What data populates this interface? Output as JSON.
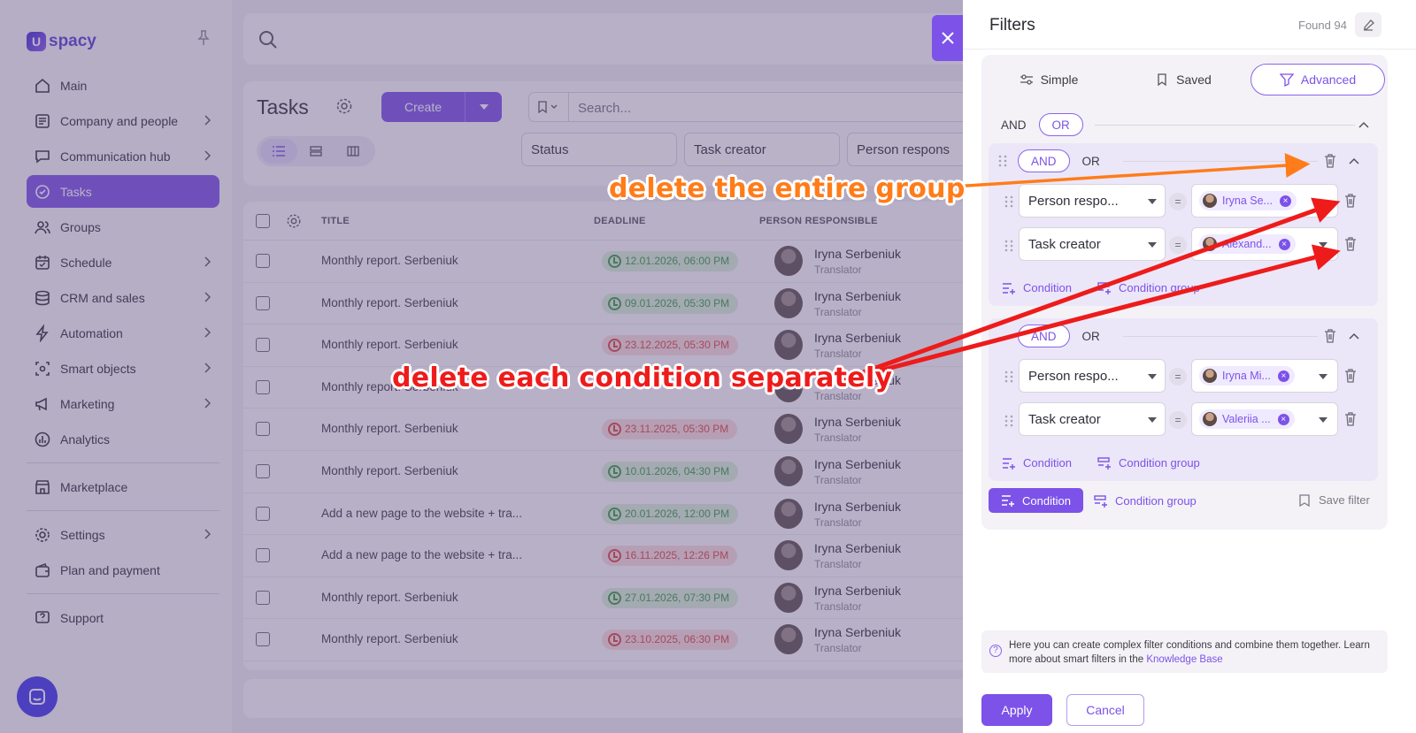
{
  "app": {
    "logo_text": "spacy",
    "sidebar": [
      {
        "label": "Main",
        "icon": "home-icon",
        "chevron": false
      },
      {
        "label": "Company and people",
        "icon": "company-icon",
        "chevron": true
      },
      {
        "label": "Communication hub",
        "icon": "chat-icon",
        "chevron": true
      },
      {
        "label": "Tasks",
        "icon": "tasks-icon",
        "chevron": false,
        "active": true
      },
      {
        "label": "Groups",
        "icon": "groups-icon",
        "chevron": false
      },
      {
        "label": "Schedule",
        "icon": "calendar-icon",
        "chevron": true
      },
      {
        "label": "CRM and sales",
        "icon": "database-icon",
        "chevron": true
      },
      {
        "label": "Automation",
        "icon": "lightning-icon",
        "chevron": true
      },
      {
        "label": "Smart objects",
        "icon": "smart-objects-icon",
        "chevron": true
      },
      {
        "label": "Marketing",
        "icon": "megaphone-icon",
        "chevron": true
      },
      {
        "label": "Analytics",
        "icon": "analytics-icon",
        "chevron": false
      }
    ],
    "sidebar_bottom": [
      {
        "label": "Marketplace",
        "icon": "store-icon",
        "chevron": false
      },
      {
        "label": "Settings",
        "icon": "gear-icon",
        "chevron": true
      },
      {
        "label": "Plan and payment",
        "icon": "wallet-icon",
        "chevron": false
      },
      {
        "label": "Support",
        "icon": "support-icon",
        "chevron": false
      }
    ]
  },
  "tasks": {
    "title": "Tasks",
    "create_label": "Create",
    "search_placeholder": "Search...",
    "filters": [
      "Status",
      "Task creator",
      "Person respons"
    ],
    "columns": {
      "title": "TITLE",
      "deadline": "DEADLINE",
      "person": "PERSON RESPONSIBLE"
    },
    "rows": [
      {
        "title": "Monthly report. Serbeniuk",
        "deadline": "12.01.2026, 06:00 PM",
        "status": "green",
        "person": "Iryna Serbeniuk",
        "role": "Translator"
      },
      {
        "title": "Monthly report. Serbeniuk",
        "deadline": "09.01.2026, 05:30 PM",
        "status": "green",
        "person": "Iryna Serbeniuk",
        "role": "Translator"
      },
      {
        "title": "Monthly report. Serbeniuk",
        "deadline": "23.12.2025, 05:30 PM",
        "status": "red",
        "person": "Iryna Serbeniuk",
        "role": "Translator"
      },
      {
        "title": "Monthly report. Serbeniuk",
        "deadline": "",
        "status": "none",
        "person": "Iryna Serbeniuk",
        "role": "Translator"
      },
      {
        "title": "Monthly report. Serbeniuk",
        "deadline": "23.11.2025, 05:30 PM",
        "status": "red",
        "person": "Iryna Serbeniuk",
        "role": "Translator"
      },
      {
        "title": "Monthly report. Serbeniuk",
        "deadline": "10.01.2026, 04:30 PM",
        "status": "green",
        "person": "Iryna Serbeniuk",
        "role": "Translator"
      },
      {
        "title": "Add a new page to the website + tra...",
        "deadline": "20.01.2026, 12:00 PM",
        "status": "green",
        "person": "Iryna Serbeniuk",
        "role": "Translator"
      },
      {
        "title": "Add a new page to the website + tra...",
        "deadline": "16.11.2025, 12:26 PM",
        "status": "red",
        "person": "Iryna Serbeniuk",
        "role": "Translator"
      },
      {
        "title": "Monthly report. Serbeniuk",
        "deadline": "27.01.2026, 07:30 PM",
        "status": "green",
        "person": "Iryna Serbeniuk",
        "role": "Translator"
      },
      {
        "title": "Monthly report. Serbeniuk",
        "deadline": "23.10.2025, 06:30 PM",
        "status": "red",
        "person": "Iryna Serbeniuk",
        "role": "Translator"
      }
    ]
  },
  "panel": {
    "title": "Filters",
    "found": "Found 94",
    "modes": [
      "Simple",
      "Saved",
      "Advanced"
    ],
    "active_mode": "Advanced",
    "root_ops": [
      "AND",
      "OR"
    ],
    "root_active": "OR",
    "groups": [
      {
        "ops": [
          "AND",
          "OR"
        ],
        "active": "AND",
        "conditions": [
          {
            "field": "Person respo...",
            "op": "=",
            "value": "Iryna Se..."
          },
          {
            "field": "Task creator",
            "op": "=",
            "value": "Alexand..."
          }
        ],
        "add_condition": "Condition",
        "add_group": "Condition group"
      },
      {
        "ops": [
          "AND",
          "OR"
        ],
        "active": "AND",
        "conditions": [
          {
            "field": "Person respo...",
            "op": "=",
            "value": "Iryna Mi..."
          },
          {
            "field": "Task creator",
            "op": "=",
            "value": "Valeriia ..."
          }
        ],
        "add_condition": "Condition",
        "add_group": "Condition group"
      }
    ],
    "condition_btn": "Condition",
    "condition_group_btn": "Condition group",
    "save_filter": "Save filter",
    "info_text": "Here you can create complex filter conditions and combine them together. Learn more about smart filters in the ",
    "info_link": "Knowledge Base",
    "apply": "Apply",
    "cancel": "Cancel"
  },
  "annotations": {
    "group_note": "delete the entire group",
    "condition_note": "delete each condition separately",
    "group_color": "#ff7c1a",
    "condition_color": "#ee1b1b"
  },
  "colors": {
    "accent": "#7c52e9",
    "overlay": "rgba(96,79,128,.43)"
  }
}
